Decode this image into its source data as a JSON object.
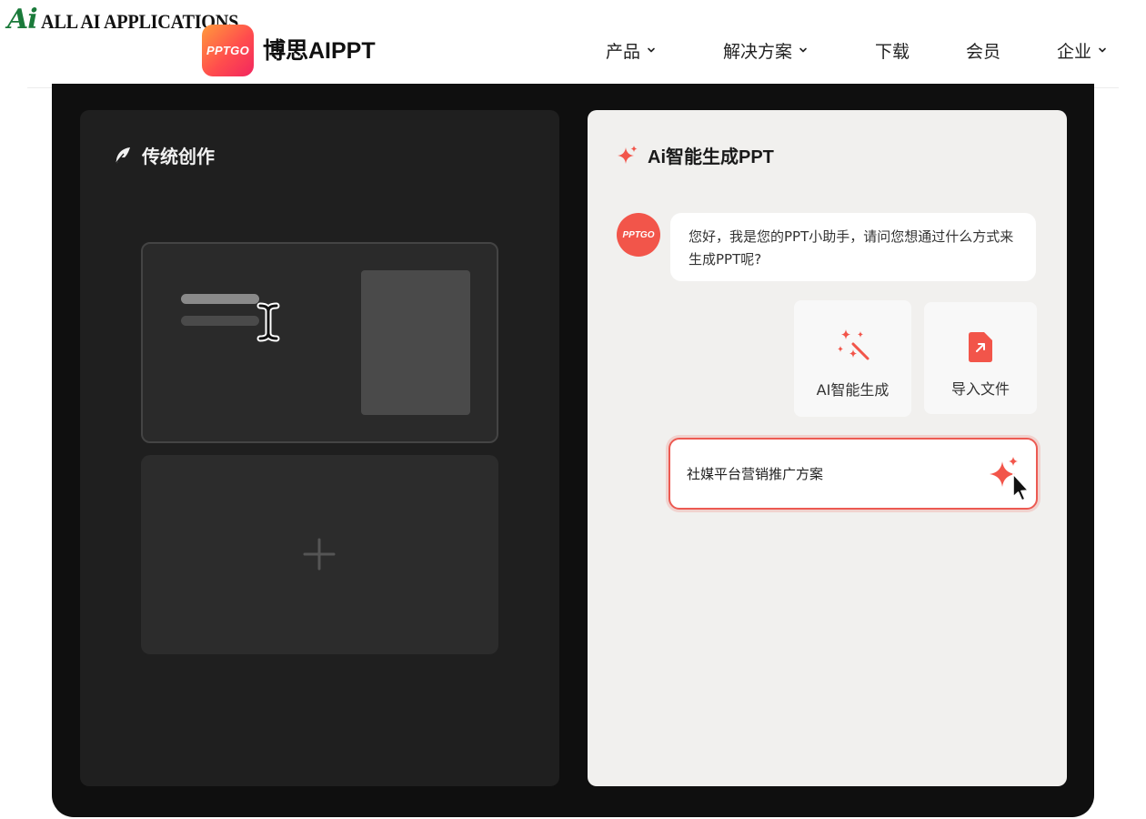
{
  "watermark": {
    "logo_text": "Ai",
    "text": "ALL AI APPLICATIONS"
  },
  "header": {
    "logo_text": "PPTGO",
    "brand": "博思AIPPT",
    "nav": [
      {
        "label": "产品",
        "has_dropdown": true
      },
      {
        "label": "解决方案",
        "has_dropdown": true
      },
      {
        "label": "下载",
        "has_dropdown": false
      },
      {
        "label": "会员",
        "has_dropdown": false
      },
      {
        "label": "企业",
        "has_dropdown": true
      }
    ]
  },
  "left_panel": {
    "title": "传统创作",
    "icon": "feather-icon"
  },
  "right_panel": {
    "title": "Ai智能生成PPT",
    "icon": "sparkle-icon",
    "assistant": {
      "avatar_text": "PPTGO",
      "message": "您好，我是您的PPT小助手，请问您想通过什么方式来生成PPT呢?"
    },
    "options": [
      {
        "label": "AI智能生成",
        "icon": "magic-wand-icon"
      },
      {
        "label": "导入文件",
        "icon": "file-import-icon"
      }
    ],
    "input": {
      "value": "社媒平台营销推广方案"
    }
  },
  "colors": {
    "accent": "#f2554a",
    "frame": "#0f0f0f",
    "left_panel": "#1f1f1f",
    "right_panel": "#f1f0ee"
  }
}
